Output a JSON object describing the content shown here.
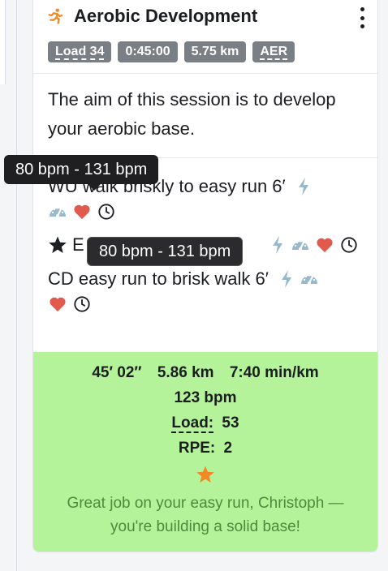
{
  "session": {
    "title": "Aerobic Development",
    "activity_icon": "runner-icon",
    "menu_icon": "kebab-menu-icon",
    "badges": {
      "load": "Load 34",
      "duration": "0:45:00",
      "distance": "5.75 km",
      "type": "AER"
    },
    "description": "The aim of this session is to develop your aerobic base."
  },
  "steps": [
    {
      "text": "WU walk briskly to easy run 6′",
      "icons": [
        "bolt-icon",
        "speedometer-icon",
        "heart-icon",
        "clock-icon"
      ]
    },
    {
      "prefix_icon": "star-icon",
      "text": "E",
      "icons": [
        "bolt-icon",
        "speedometer-icon",
        "heart-icon",
        "clock-icon"
      ]
    },
    {
      "text": "CD easy run to brisk walk 6′",
      "icons": [
        "bolt-icon",
        "speedometer-icon",
        "heart-icon",
        "clock-icon"
      ]
    }
  ],
  "tooltips": {
    "primary": "80 bpm - 131 bpm",
    "secondary": "80 bpm - 131 bpm"
  },
  "summary": {
    "time": "45′ 02″",
    "distance": "5.86 km",
    "pace": "7:40 min/km",
    "heart_rate": "123 bpm",
    "load_label": "Load:",
    "load_value": "53",
    "rpe_label": "RPE:",
    "rpe_value": "2",
    "rating_icon": "star-icon",
    "message": "Great job on your easy run, Christoph —you're building a solid base!"
  },
  "colors": {
    "summary_bg": "#b5f39b",
    "message_text": "#4f8a3b",
    "badge_bg": "#7a7e85",
    "heart": "#e05a4e",
    "bolt": "#9ab8cc",
    "star_rating": "#f08a24",
    "runner": "#f08a24"
  }
}
